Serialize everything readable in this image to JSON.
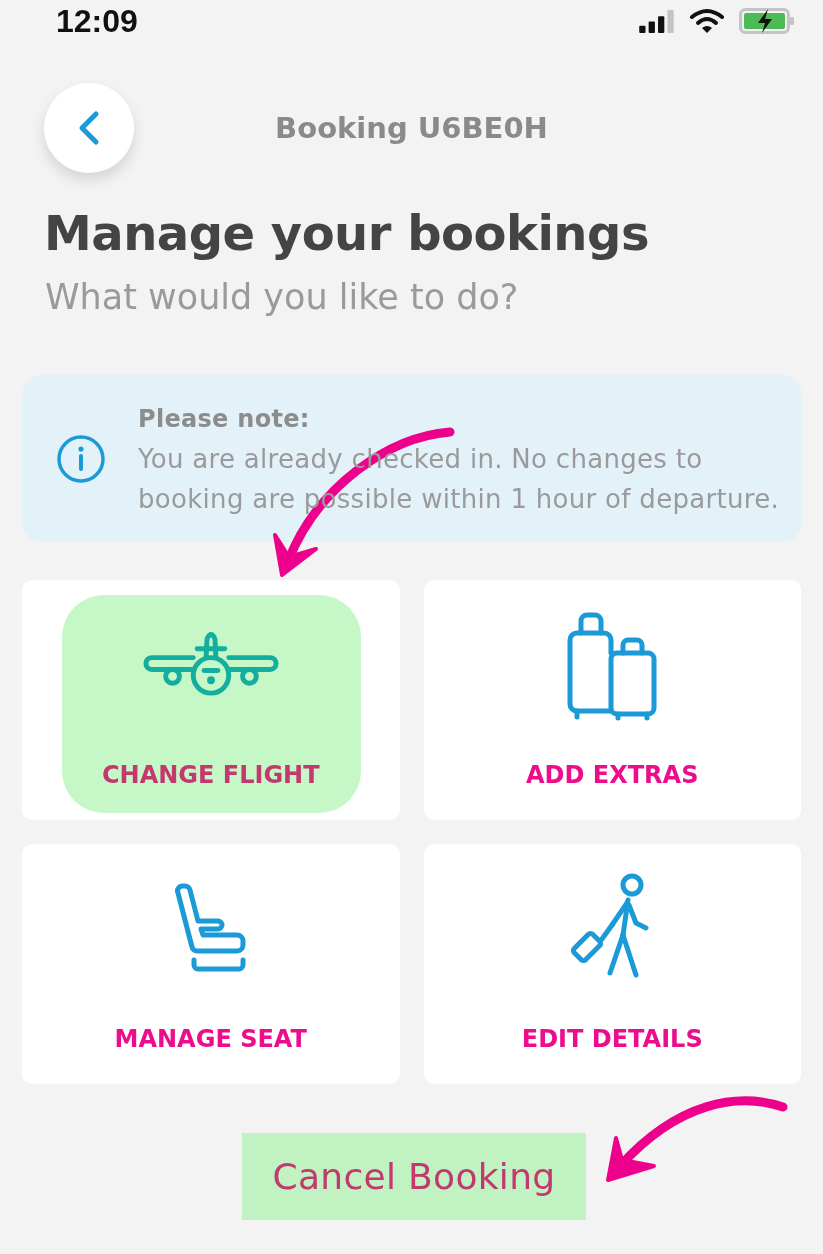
{
  "status_bar": {
    "time": "12:09"
  },
  "header": {
    "title": "Booking U6BE0H"
  },
  "heading": "Manage your bookings",
  "subheading": "What would you like to do?",
  "notice": {
    "title": "Please note:",
    "text": "You are already checked in. No changes to booking are possible within 1 hour of departure."
  },
  "tiles": [
    {
      "label": "CHANGE FLIGHT",
      "highlighted": true,
      "arrow": true
    },
    {
      "label": "ADD EXTRAS",
      "highlighted": false,
      "arrow": false
    },
    {
      "label": "MANAGE SEAT",
      "highlighted": false,
      "arrow": false
    },
    {
      "label": "EDIT DETAILS",
      "highlighted": false,
      "arrow": false
    }
  ],
  "cancel_button": {
    "label": "Cancel Booking",
    "highlighted": true,
    "arrow": true
  }
}
